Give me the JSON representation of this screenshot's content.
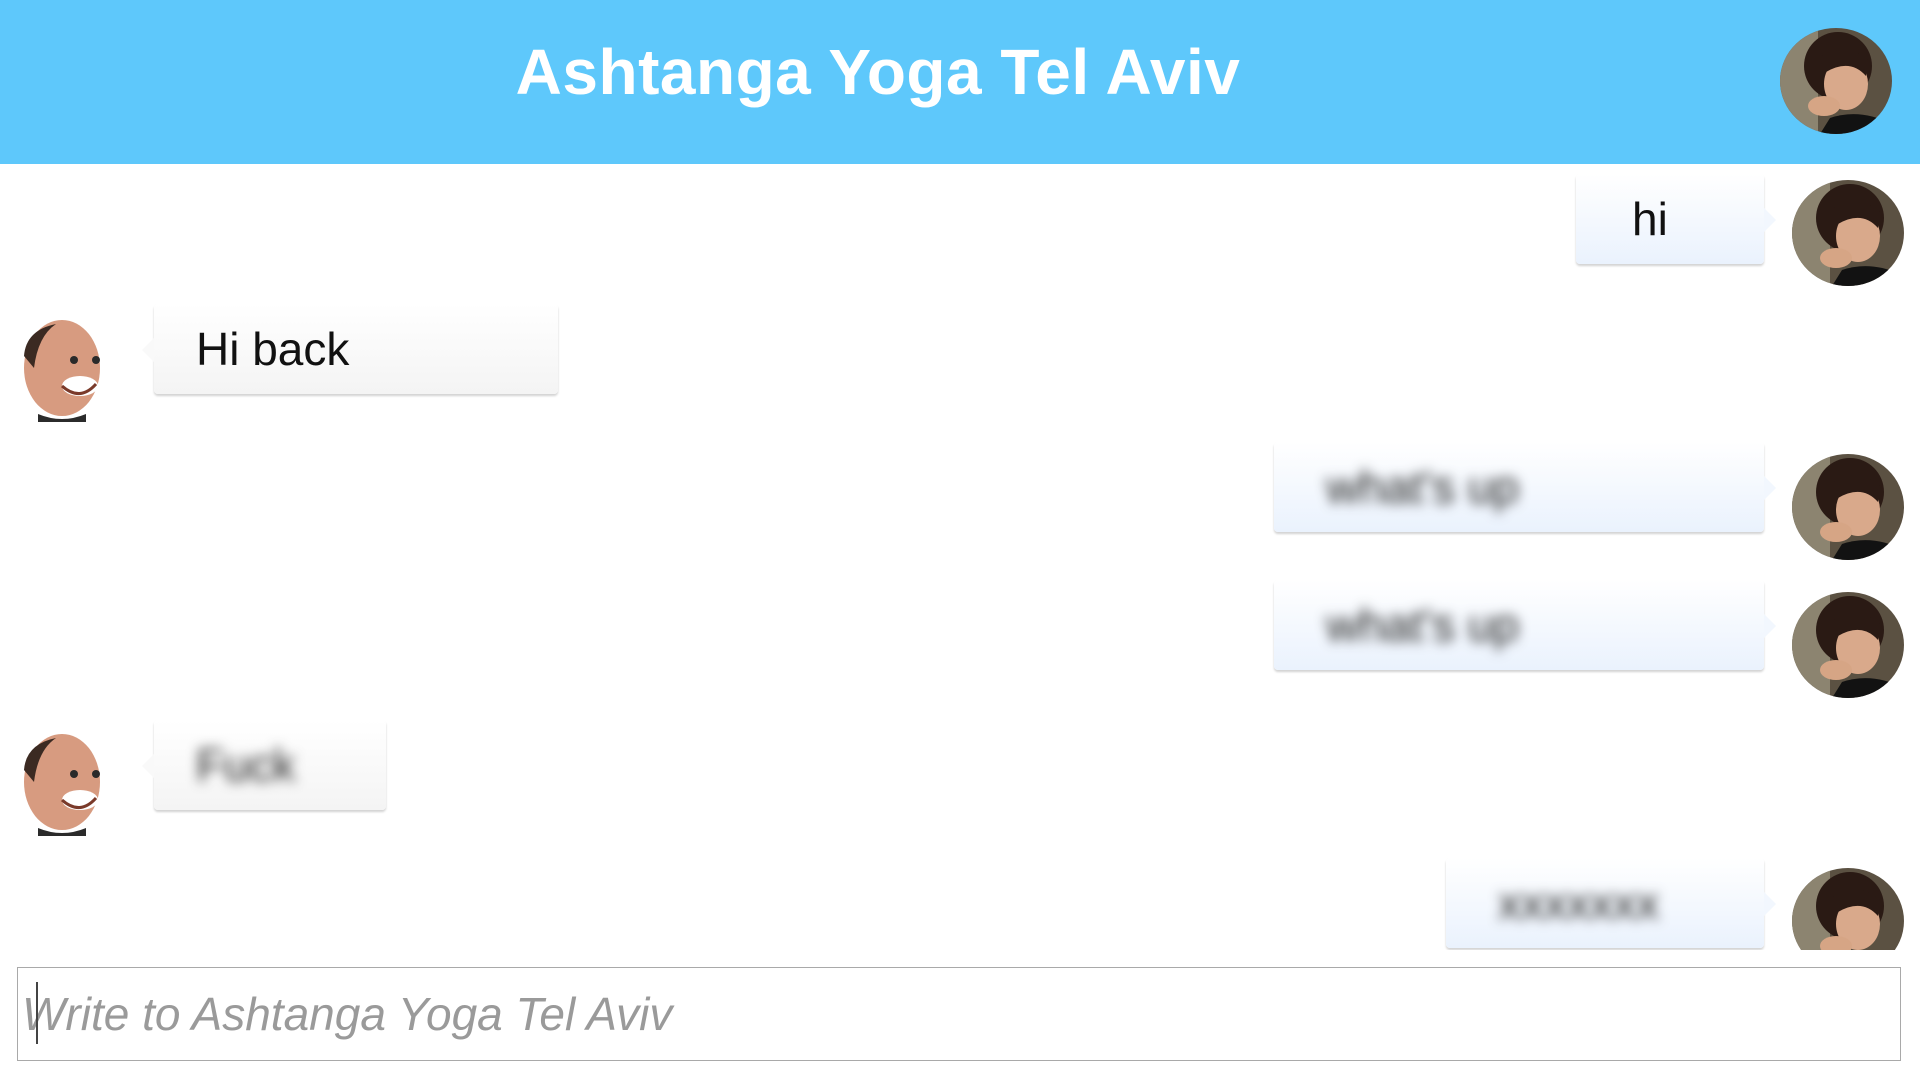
{
  "header": {
    "title": "Ashtanga Yoga Tel Aviv",
    "avatar_icon": "woman-avatar-icon"
  },
  "messages": [
    {
      "direction": "sent",
      "text": "hi",
      "blurred": false,
      "avatar_icon": "woman-avatar-icon"
    },
    {
      "direction": "received",
      "text": "Hi back",
      "blurred": false,
      "avatar_icon": "man-avatar-icon"
    },
    {
      "direction": "sent",
      "text": "what's up",
      "blurred": true,
      "avatar_icon": "woman-avatar-icon"
    },
    {
      "direction": "sent",
      "text": "what's up",
      "blurred": true,
      "avatar_icon": "woman-avatar-icon"
    },
    {
      "direction": "received",
      "text": "Fuck",
      "blurred": true,
      "avatar_icon": "man-avatar-icon"
    },
    {
      "direction": "sent",
      "text": "xxxxxxx",
      "blurred": true,
      "avatar_icon": "woman-avatar-icon"
    }
  ],
  "composer": {
    "placeholder": "Write to Ashtanga Yoga Tel Aviv",
    "value": ""
  },
  "colors": {
    "header_bg": "#5ec8fb",
    "header_text": "#ffffff",
    "sent_bubble": "#eaf2fd",
    "received_bubble": "#f4f4f4"
  }
}
